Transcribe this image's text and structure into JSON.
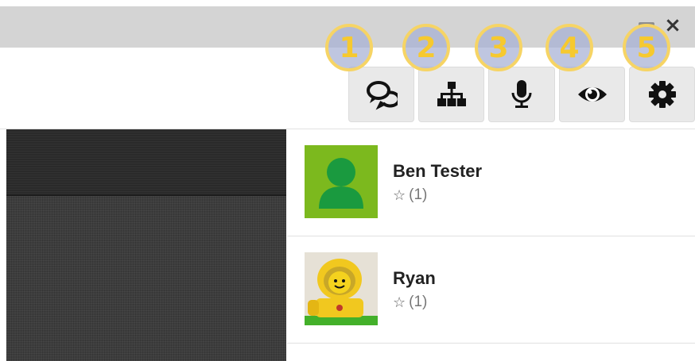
{
  "window": {
    "minimize_label": "",
    "close_label": "×"
  },
  "toolbar": {
    "buttons": [
      {
        "icon": "chat-icon",
        "badge": "1"
      },
      {
        "icon": "hierarchy-icon",
        "badge": "2"
      },
      {
        "icon": "microphone-icon",
        "badge": "3"
      },
      {
        "icon": "eye-icon",
        "badge": "4"
      },
      {
        "icon": "gear-icon",
        "badge": "5"
      }
    ]
  },
  "participants": [
    {
      "name": "Ben Tester",
      "rating": "(1)",
      "avatar_icon": "default-user-icon",
      "avatar_color": "#7cb91e"
    },
    {
      "name": "Ryan",
      "rating": "(1)",
      "avatar_icon": "lego-astronaut-avatar",
      "avatar_color": "#f1c81f"
    }
  ],
  "colors": {
    "badge_ring": "#f6d465",
    "badge_text": "#f6c92f",
    "badge_fill": "#a6b0d4",
    "avatar_green": "#7cb91e",
    "avatar_dark_green": "#1a9a3f"
  }
}
